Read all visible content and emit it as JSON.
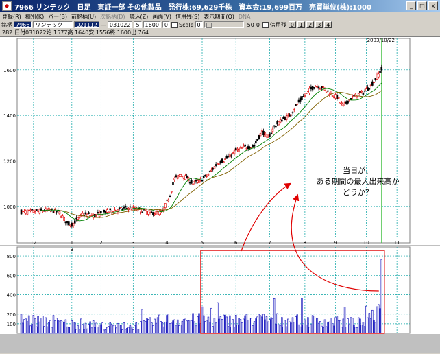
{
  "window": {
    "title": "7966 リンテック　日足　東証一部 その他製品　発行株:69,629千株　資本金:19,699百万　売買単位(株):1000",
    "app_icon": "chart-app-icon",
    "buttons": [
      "_",
      "□",
      "x"
    ]
  },
  "menu": [
    {
      "label": "登録(R)",
      "enabled": true
    },
    {
      "label": "種別(K)",
      "enabled": true
    },
    {
      "label": "バー(B)",
      "enabled": true
    },
    {
      "label": "前銘柄(U)",
      "enabled": true
    },
    {
      "label": "次銘柄(D)",
      "enabled": false
    },
    {
      "label": "読込(Z)",
      "enabled": true
    },
    {
      "label": "画面(V)",
      "enabled": true
    },
    {
      "label": "信用残(S)",
      "enabled": true
    },
    {
      "label": "表示期間(Q)",
      "enabled": true
    },
    {
      "label": "DNA",
      "enabled": false
    }
  ],
  "toolbar": {
    "code_label": "銘柄",
    "code_value": "7966",
    "name_value": "リンテック",
    "date_from": "021112",
    "date_to": "031022",
    "field1": "5",
    "field2": "1600",
    "field3": "0",
    "scale_label": "Scale",
    "scale_value": "0",
    "n50": "50",
    "n0": "0",
    "margin_label": "信用残",
    "pages": [
      "0",
      "1",
      "2",
      "3",
      "4"
    ]
  },
  "info_line": "282:日付031022始 1577高 1640安 1556終 1600出 764",
  "annotation": {
    "line1": "当日が、",
    "line2": "ある期間の最大出来高か",
    "line3": "どうか？",
    "date_label": "2003/10/22",
    "arrow_color": "#e00000",
    "box_color": "#e00000"
  },
  "chart_data": {
    "type": "candlestick",
    "price_axis": {
      "ticks": [
        1000,
        1200,
        1400,
        1600
      ],
      "range": [
        900,
        1720
      ]
    },
    "volume_axis": {
      "ticks": [
        100,
        200,
        400,
        600,
        800
      ],
      "range": [
        0,
        850
      ]
    },
    "x_axis": {
      "month_labels": [
        "12",
        "1",
        "2",
        "3",
        "4",
        "5",
        "6",
        "7",
        "8",
        "9",
        "10",
        "11"
      ],
      "year_label": "3"
    },
    "price_keypoints": [
      [
        0,
        975
      ],
      [
        10,
        978
      ],
      [
        18,
        985
      ],
      [
        25,
        972
      ],
      [
        30,
        925
      ],
      [
        33,
        920
      ],
      [
        40,
        965
      ],
      [
        48,
        960
      ],
      [
        55,
        975
      ],
      [
        62,
        985
      ],
      [
        70,
        995
      ],
      [
        78,
        985
      ],
      [
        85,
        970
      ],
      [
        92,
        975
      ],
      [
        97,
        1050
      ],
      [
        100,
        1120
      ],
      [
        104,
        1140
      ],
      [
        108,
        1125
      ],
      [
        112,
        1100
      ],
      [
        117,
        1115
      ],
      [
        122,
        1140
      ],
      [
        128,
        1190
      ],
      [
        134,
        1210
      ],
      [
        140,
        1245
      ],
      [
        146,
        1260
      ],
      [
        152,
        1265
      ],
      [
        157,
        1330
      ],
      [
        161,
        1300
      ],
      [
        165,
        1350
      ],
      [
        170,
        1380
      ],
      [
        175,
        1400
      ],
      [
        180,
        1450
      ],
      [
        184,
        1480
      ],
      [
        188,
        1510
      ],
      [
        192,
        1530
      ],
      [
        197,
        1520
      ],
      [
        202,
        1495
      ],
      [
        206,
        1480
      ],
      [
        210,
        1440
      ],
      [
        214,
        1470
      ],
      [
        219,
        1490
      ],
      [
        223,
        1500
      ],
      [
        228,
        1530
      ],
      [
        232,
        1570
      ],
      [
        235,
        1600
      ]
    ],
    "volume_keypoints": [
      [
        0,
        150
      ],
      [
        40,
        90
      ],
      [
        70,
        70
      ],
      [
        95,
        150
      ],
      [
        130,
        140
      ],
      [
        160,
        150
      ],
      [
        200,
        130
      ],
      [
        225,
        110
      ],
      [
        233,
        260
      ],
      [
        235,
        764
      ]
    ],
    "colors": {
      "up": "#e00000",
      "down": "#000000",
      "ma_short": "#008000",
      "ma_long": "#806000",
      "volume": "#2020c0",
      "grid": "#00a0a0",
      "vertical_marker": "#40c040"
    }
  }
}
